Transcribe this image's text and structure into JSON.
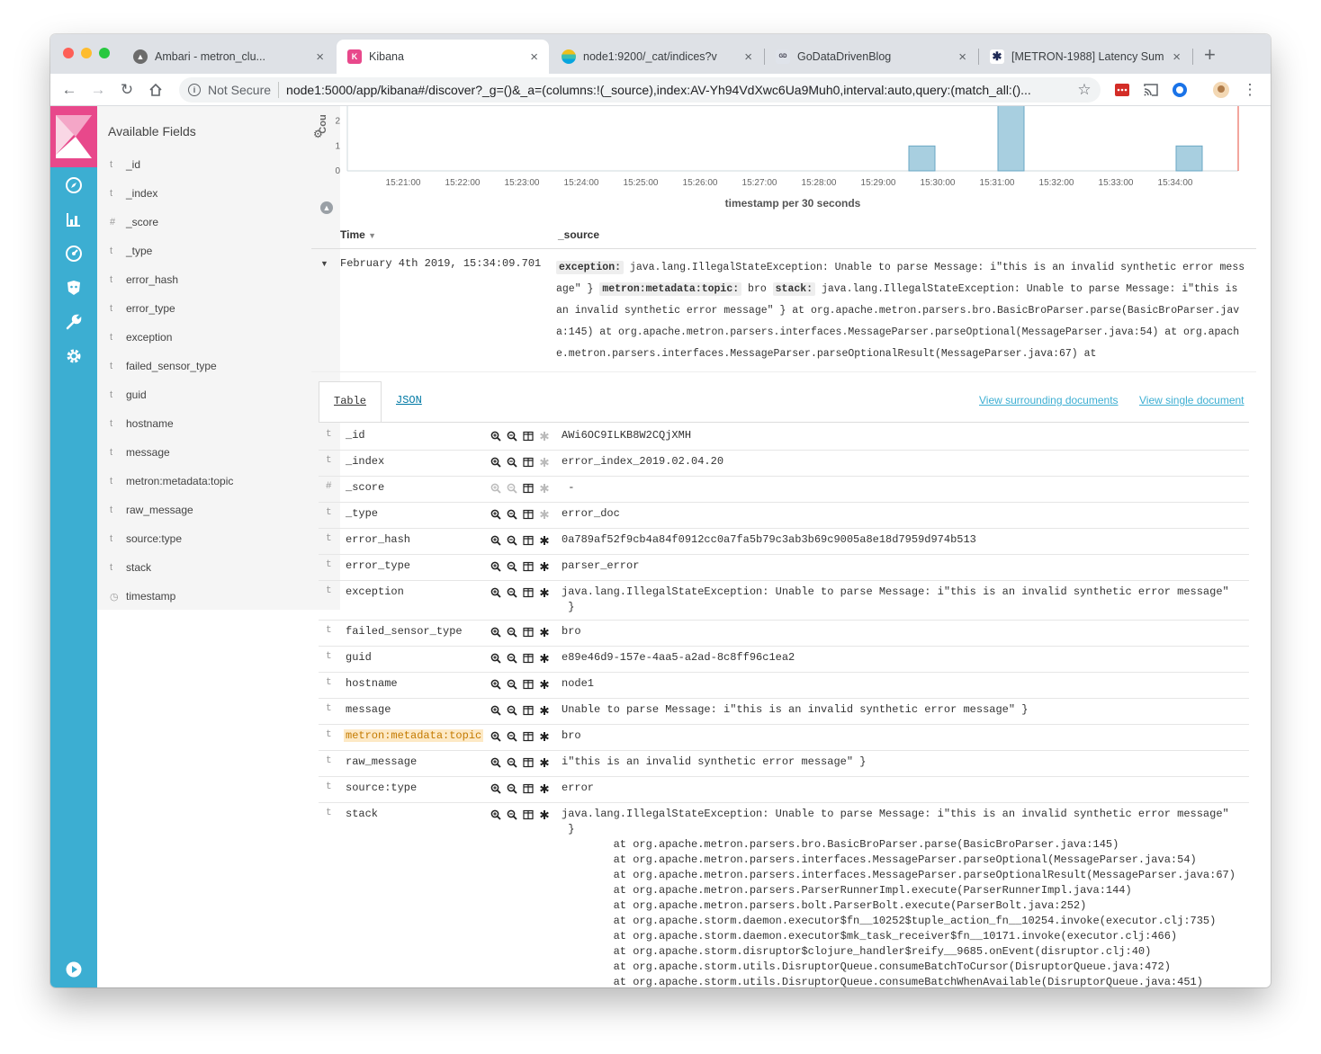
{
  "browser": {
    "tabs": [
      {
        "title": "Ambari - metron_clu..."
      },
      {
        "title": "Kibana"
      },
      {
        "title": "node1:9200/_cat/indices?v"
      },
      {
        "title": "GoDataDrivenBlog"
      },
      {
        "title": "[METRON-1988] Latency Sum"
      }
    ],
    "new_tab": "+",
    "close_glyph": "×",
    "security_label": "Not Secure",
    "url": "node1:5000/app/kibana#/discover?_g=()&_a=(columns:!(_source),index:AV-Yh94VdXwc6Ua9Muh0,interval:auto,query:(match_all:()..."
  },
  "nav_icons": [
    "discover-icon",
    "visualize-icon",
    "dashboard-icon",
    "timelion-icon",
    "dev-tools-icon",
    "management-icon",
    "collapse-icon"
  ],
  "sidebar": {
    "title": "Available Fields",
    "fields": [
      {
        "type": "t",
        "name": "_id"
      },
      {
        "type": "t",
        "name": "_index"
      },
      {
        "type": "#",
        "name": "_score"
      },
      {
        "type": "t",
        "name": "_type"
      },
      {
        "type": "t",
        "name": "error_hash"
      },
      {
        "type": "t",
        "name": "error_type"
      },
      {
        "type": "t",
        "name": "exception"
      },
      {
        "type": "t",
        "name": "failed_sensor_type"
      },
      {
        "type": "t",
        "name": "guid"
      },
      {
        "type": "t",
        "name": "hostname"
      },
      {
        "type": "t",
        "name": "message"
      },
      {
        "type": "t",
        "name": "metron:metadata:topic"
      },
      {
        "type": "t",
        "name": "raw_message"
      },
      {
        "type": "t",
        "name": "source:type"
      },
      {
        "type": "t",
        "name": "stack"
      },
      {
        "type": "clock",
        "name": "timestamp"
      }
    ]
  },
  "chart_data": {
    "type": "bar",
    "title": "",
    "xlabel": "timestamp per 30 seconds",
    "ylabel": "Cou",
    "yticks": [
      0,
      1,
      2
    ],
    "ylim": [
      0,
      2.6
    ],
    "x_tick_labels": [
      "15:21:00",
      "15:22:00",
      "15:23:00",
      "15:24:00",
      "15:25:00",
      "15:26:00",
      "15:27:00",
      "15:28:00",
      "15:29:00",
      "15:30:00",
      "15:31:00",
      "15:32:00",
      "15:33:00",
      "15:34:00"
    ],
    "bars": [
      {
        "bucket": "15:29:30",
        "value": 1
      },
      {
        "bucket": "15:31:00",
        "value": 3
      },
      {
        "bucket": "15:34:00",
        "value": 1
      }
    ],
    "color": "#a8cfe0"
  },
  "table": {
    "col_time": "Time",
    "col_source": "_source",
    "doc": {
      "time": "February 4th 2019, 15:34:09.701",
      "source_parts": [
        {
          "k": "exception:",
          "v": " java.lang.IllegalStateException: Unable to parse Message: i\"this is an invalid synthetic error message\" } "
        },
        {
          "k": "metron:metadata:topic:",
          "v": " bro "
        },
        {
          "k": "stack:",
          "v": " java.lang.IllegalStateException: Unable to parse Message: i\"this is an invalid synthetic error message\" } at org.apache.metron.parsers.bro.BasicBroParser.parse(BasicBroParser.java:145) at org.apache.metron.parsers.interfaces.MessageParser.parseOptional(MessageParser.java:54) at org.apache.metron.parsers.interfaces.MessageParser.parseOptionalResult(MessageParser.java:67) at"
        }
      ]
    }
  },
  "details": {
    "tab_table": "Table",
    "tab_json": "JSON",
    "link_surrounding": "View surrounding documents",
    "link_single": "View single document",
    "rows": [
      {
        "type": "t",
        "name": "_id",
        "value": "AWi6OC9ILKB8W2CQjXMH"
      },
      {
        "type": "t",
        "name": "_index",
        "value": "error_index_2019.02.04.20"
      },
      {
        "type": "#",
        "name": "_score",
        "value": " -"
      },
      {
        "type": "t",
        "name": "_type",
        "value": "error_doc"
      },
      {
        "type": "t",
        "name": "error_hash",
        "value": "0a789af52f9cb4a84f0912cc0a7fa5b79c3ab3b69c9005a8e18d7959d974b513"
      },
      {
        "type": "t",
        "name": "error_type",
        "value": "parser_error"
      },
      {
        "type": "t",
        "name": "exception",
        "value": "java.lang.IllegalStateException: Unable to parse Message: i\"this is an invalid synthetic error message\"\n }"
      },
      {
        "type": "t",
        "name": "failed_sensor_type",
        "value": "bro"
      },
      {
        "type": "t",
        "name": "guid",
        "value": "e89e46d9-157e-4aa5-a2ad-8c8ff96c1ea2"
      },
      {
        "type": "t",
        "name": "hostname",
        "value": "node1"
      },
      {
        "type": "t",
        "name": "message",
        "value": "Unable to parse Message: i\"this is an invalid synthetic error message\" }"
      },
      {
        "type": "t",
        "name": "metron:metadata:topic",
        "value": "bro"
      },
      {
        "type": "t",
        "name": "raw_message",
        "value": "i\"this is an invalid synthetic error message\" }"
      },
      {
        "type": "t",
        "name": "source:type",
        "value": "error"
      },
      {
        "type": "t",
        "name": "stack",
        "value": "java.lang.IllegalStateException: Unable to parse Message: i\"this is an invalid synthetic error message\"\n }\n        at org.apache.metron.parsers.bro.BasicBroParser.parse(BasicBroParser.java:145)\n        at org.apache.metron.parsers.interfaces.MessageParser.parseOptional(MessageParser.java:54)\n        at org.apache.metron.parsers.interfaces.MessageParser.parseOptionalResult(MessageParser.java:67)\n        at org.apache.metron.parsers.ParserRunnerImpl.execute(ParserRunnerImpl.java:144)\n        at org.apache.metron.parsers.bolt.ParserBolt.execute(ParserBolt.java:252)\n        at org.apache.storm.daemon.executor$fn__10252$tuple_action_fn__10254.invoke(executor.clj:735)\n        at org.apache.storm.daemon.executor$mk_task_receiver$fn__10171.invoke(executor.clj:466)\n        at org.apache.storm.disruptor$clojure_handler$reify__9685.onEvent(disruptor.clj:40)\n        at org.apache.storm.utils.DisruptorQueue.consumeBatchToCursor(DisruptorQueue.java:472)\n        at org.apache.storm.utils.DisruptorQueue.consumeBatchWhenAvailable(DisruptorQueue.java:451)"
      }
    ]
  }
}
